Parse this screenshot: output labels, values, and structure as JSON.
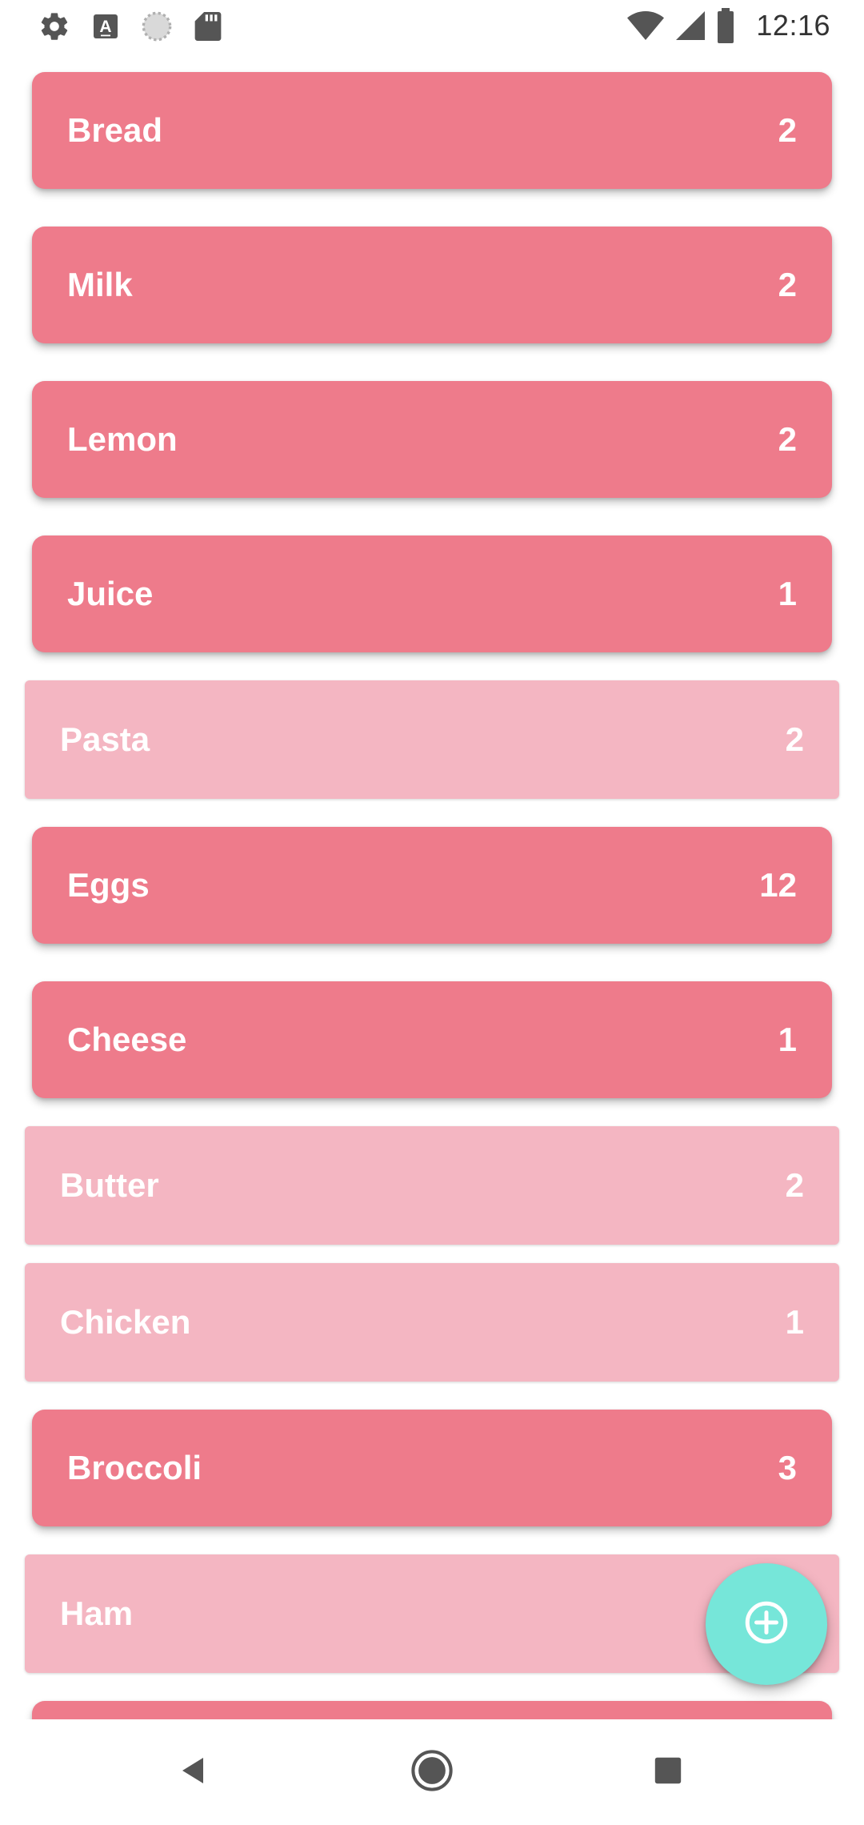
{
  "status_bar": {
    "time": "12:16",
    "icons_left": [
      "gear-icon",
      "font-a-icon",
      "loading-circle-icon",
      "sd-card-icon"
    ],
    "icons_right": [
      "wifi-icon",
      "signal-icon",
      "battery-icon"
    ]
  },
  "items": [
    {
      "name": "Bread",
      "qty": "2",
      "style": "raised"
    },
    {
      "name": "Milk",
      "qty": "2",
      "style": "raised"
    },
    {
      "name": "Lemon",
      "qty": "2",
      "style": "raised"
    },
    {
      "name": "Juice",
      "qty": "1",
      "style": "raised"
    },
    {
      "name": "Pasta",
      "qty": "2",
      "style": "flat"
    },
    {
      "name": "Eggs",
      "qty": "12",
      "style": "raised"
    },
    {
      "name": "Cheese",
      "qty": "1",
      "style": "raised"
    },
    {
      "name": "Butter",
      "qty": "2",
      "style": "flat"
    },
    {
      "name": "Chicken",
      "qty": "1",
      "style": "flat"
    },
    {
      "name": "Broccoli",
      "qty": "3",
      "style": "raised"
    },
    {
      "name": "Ham",
      "qty": "",
      "style": "flat"
    },
    {
      "name": "",
      "qty": "",
      "style": "raised"
    }
  ],
  "fab": {
    "icon": "add-circle-icon",
    "color": "#76e6d9"
  },
  "nav": {
    "back": "back-icon",
    "home": "home-icon",
    "recents": "recents-icon"
  },
  "colors": {
    "raised_item": "#ee7b8b",
    "flat_item": "#f4b6c2",
    "text": "#ffffff"
  }
}
